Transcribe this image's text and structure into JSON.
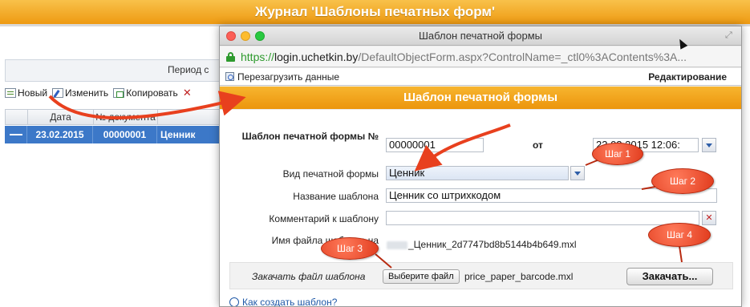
{
  "journal": {
    "title": "Журнал 'Шаблоны печатных форм'",
    "period_label": "Период с",
    "toolbar": {
      "new_label": "Новый",
      "edit_label": "Изменить",
      "copy_label": "Копировать",
      "delete_glyph": "✕"
    },
    "grid": {
      "columns": [
        "Дата",
        "№ документа"
      ],
      "rows": [
        {
          "marker": "—",
          "date": "23.02.2015",
          "number": "00000001",
          "name": "Ценник"
        }
      ]
    }
  },
  "popup": {
    "window_title": "Шаблон печатной формы",
    "url": {
      "scheme": "https://",
      "host": "login.uchetkin.by",
      "path": "/DefaultObjectForm.aspx?ControlName=_ctl0%3AContents%3A..."
    },
    "reload_label": "Перезагрузить данные",
    "mode_label": "Редактирование",
    "form_title": "Шаблон печатной формы",
    "fields": {
      "doc_number_label": "Шаблон печатной формы №",
      "doc_number_value": "00000001",
      "from_label": "от",
      "date_value": "23.02.2015 12:06:",
      "form_type_label": "Вид печатной формы",
      "form_type_value": "Ценник",
      "template_name_label": "Название шаблона",
      "template_name_value": "Ценник со штрихкодом",
      "comment_label": "Комментарий к шаблону",
      "comment_value": "",
      "filename_label": "Имя файла шаблона на",
      "filename_value": "_Ценник_2d7747bd8b5144b4b649.mxl"
    },
    "upload": {
      "label": "Закачать файл шаблона",
      "choose_button": "Выберите файл",
      "chosen_file": "price_paper_barcode.mxl",
      "upload_button": "Закачать..."
    },
    "help_link": "Как создать шаблон?"
  },
  "annotations": {
    "step1": "Шаг 1",
    "step2": "Шаг 2",
    "step3": "Шаг 3",
    "step4": "Шаг 4",
    "accent_color": "#e8401e"
  }
}
